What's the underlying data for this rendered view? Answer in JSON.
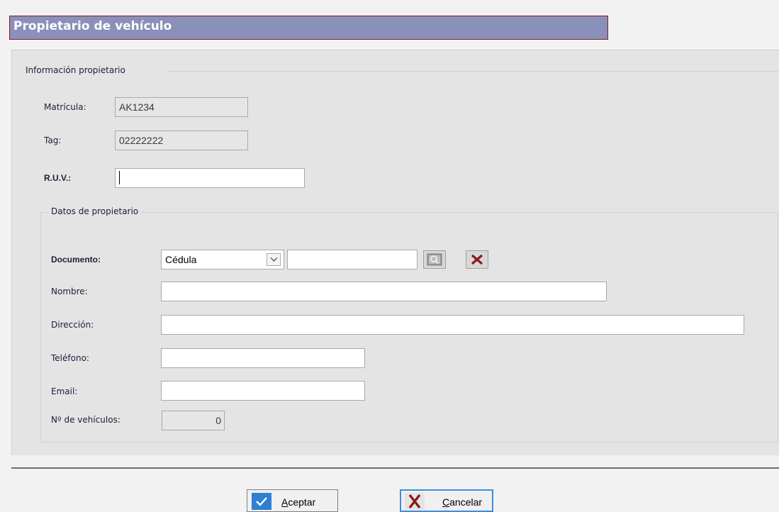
{
  "window": {
    "title": "Propietario de vehículo"
  },
  "owner_info": {
    "legend": "Información propietario",
    "plate_label": "Matrícula:",
    "plate_value": "AK1234",
    "tag_label": "Tag:",
    "tag_value": "02222222",
    "ruv_label": "R.U.V.:",
    "ruv_value": ""
  },
  "owner_data": {
    "legend": "Datos de propietario",
    "document_label": "Documento:",
    "document_type_selected": "Cédula",
    "document_number_value": "",
    "name_label": "Nombre:",
    "name_value": "",
    "address_label": "Dirección:",
    "address_value": "",
    "phone_label": "Teléfono:",
    "phone_value": "",
    "email_label": "Email:",
    "email_value": "",
    "vehicle_count_label": "Nº de vehículos:",
    "vehicle_count_value": "0"
  },
  "icons": {
    "search": "search-icon",
    "clear": "clear-x-icon",
    "dropdown": "chevron-down-icon",
    "accept": "checkmark-icon",
    "cancel": "cancel-x-icon"
  },
  "buttons": {
    "accept_label": "Aceptar",
    "accept_mnemonic": "A",
    "cancel_label": "Cancelar",
    "cancel_mnemonic": "C"
  },
  "colors": {
    "title_bar": "#8a90ba",
    "title_border": "#8b1a1a",
    "panel_bg": "#e4e4e4",
    "accent_blue": "#3c8ee0",
    "cancel_red": "#8b1a1a"
  }
}
